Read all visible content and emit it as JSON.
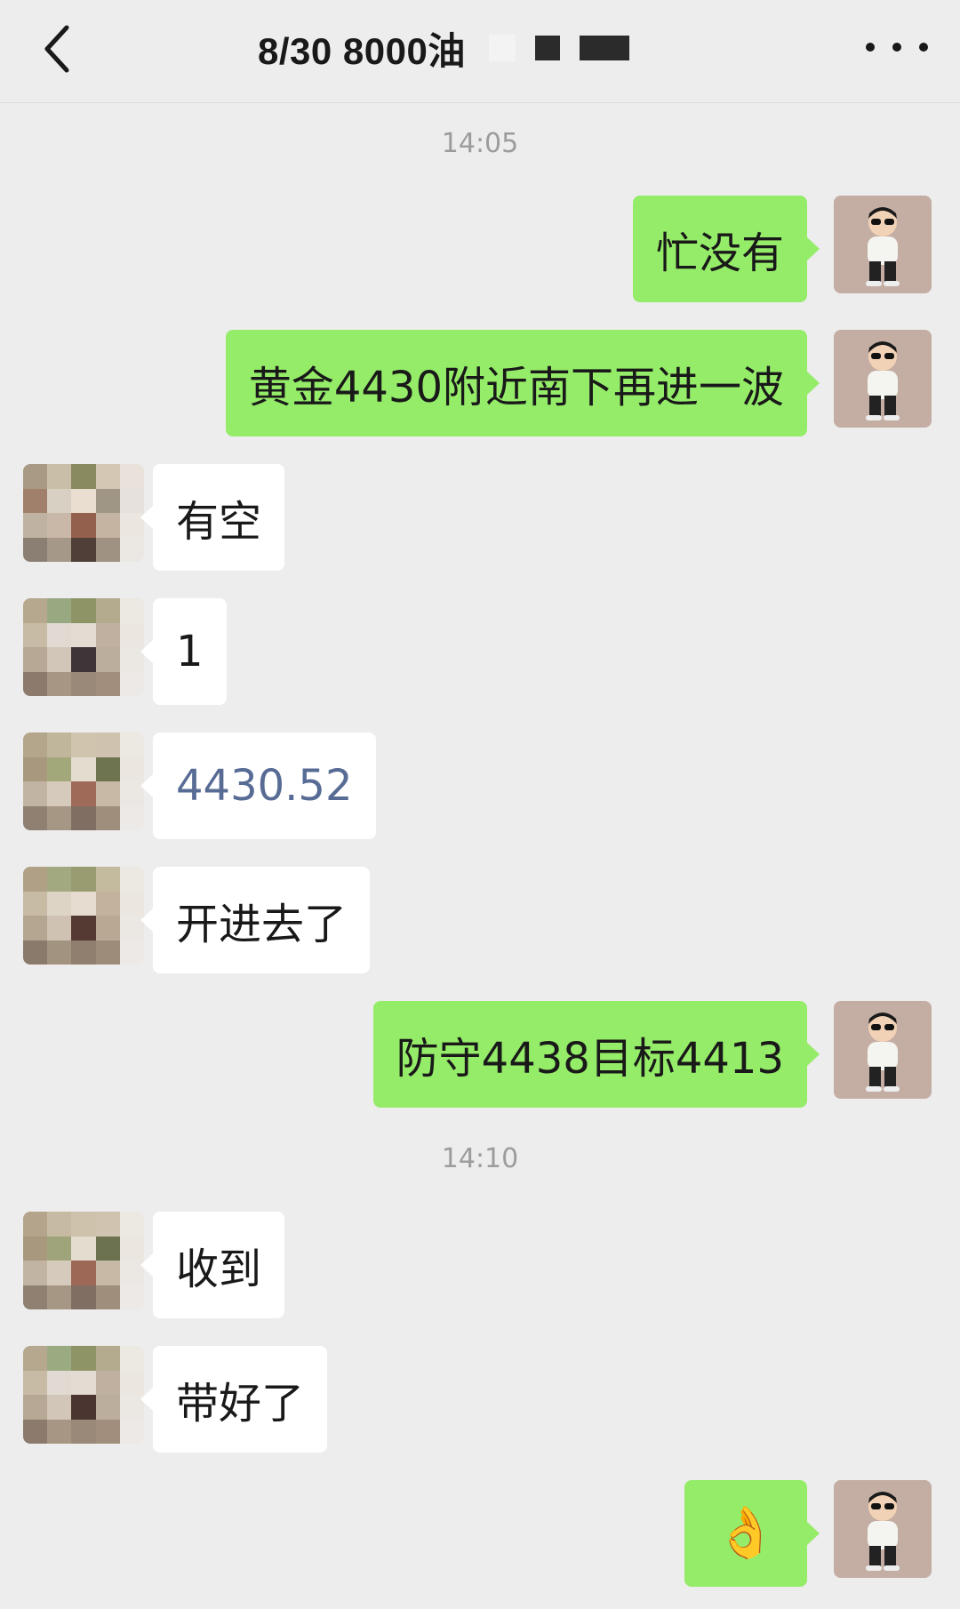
{
  "header": {
    "title": "8/30  8000油",
    "back_icon": "chevron-left-icon",
    "more_icon": "more-dots-icon"
  },
  "colors": {
    "background": "#ededed",
    "my_bubble": "#95ec69",
    "other_bubble": "#ffffff",
    "link_text": "#576b95",
    "timestamp": "#9c9c9c"
  },
  "timestamps": [
    "14:05",
    "14:10"
  ],
  "messages": [
    {
      "sender": "me",
      "text": "忙没有"
    },
    {
      "sender": "me",
      "text": "黄金4430附近南下再进一波"
    },
    {
      "sender": "other",
      "text": "有空"
    },
    {
      "sender": "other",
      "text": "1"
    },
    {
      "sender": "other",
      "text": "4430.52"
    },
    {
      "sender": "other",
      "text": "开进去了"
    },
    {
      "sender": "me",
      "text": "防守4438目标4413"
    },
    {
      "sender": "other",
      "text": "收到"
    },
    {
      "sender": "other",
      "text": "带好了"
    },
    {
      "sender": "me",
      "text": "👌"
    }
  ]
}
